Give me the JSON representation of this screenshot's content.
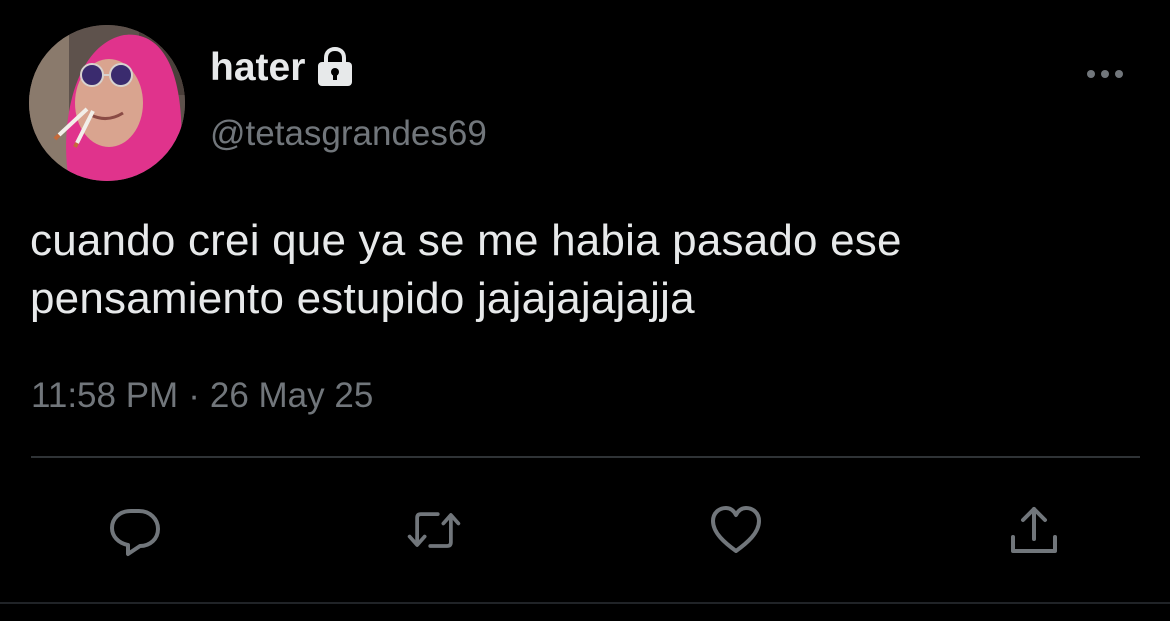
{
  "user": {
    "display_name": "hater",
    "handle": "@tetasgrandes69",
    "protected": true
  },
  "tweet": {
    "text_line_1": "cuando crei que ya se me habia pasado ese",
    "text_line_2": "pensamiento estupido jajajajajajja",
    "time": "11:58 PM",
    "separator": "·",
    "date": "26 May 25"
  },
  "icons": {
    "lock": "lock-icon",
    "more": "more-horizontal-icon",
    "reply": "comment-icon",
    "retweet": "retweet-icon",
    "like": "heart-icon",
    "share": "share-icon"
  },
  "colors": {
    "background": "#000000",
    "primary_text": "#e7e9ea",
    "secondary_text": "#71767b",
    "divider": "#2f3336",
    "icon": "#71767b"
  }
}
